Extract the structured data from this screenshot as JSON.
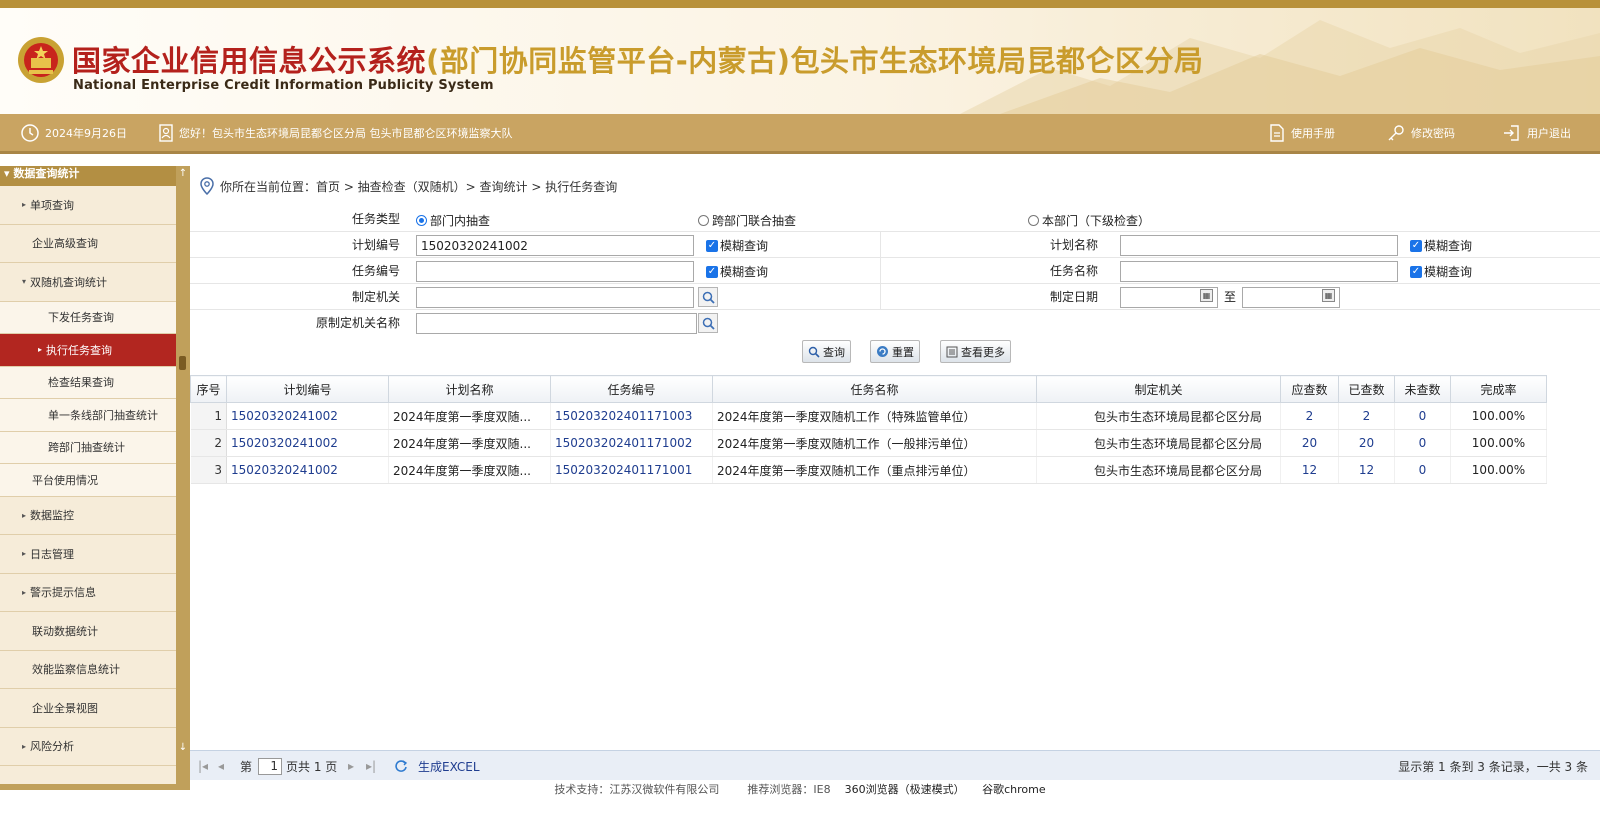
{
  "header": {
    "title_main": "国家企业信用信息公示系统",
    "title_sub": "(部门协同监管平台-内蒙古)包头市生态环境局昆都仑区分局",
    "title_en": "National Enterprise Credit Information Publicity System"
  },
  "toolbar": {
    "date": "2024年9月26日",
    "greeting": "您好！包头市生态环境局昆都仑区分局 包头市昆都仑区环境监察大队",
    "manual": "使用手册",
    "change_password": "修改密码",
    "logout": "用户退出"
  },
  "sidebar": {
    "section_title": "数据查询统计",
    "items": [
      {
        "label": "单项查询",
        "arrow": "▸"
      },
      {
        "label": "企业高级查询",
        "arrow": ""
      },
      {
        "label": "双随机查询统计",
        "arrow": "▾"
      },
      {
        "label": "下发任务查询",
        "arrow": ""
      },
      {
        "label": "执行任务查询",
        "arrow": "▸"
      },
      {
        "label": "检查结果查询",
        "arrow": ""
      },
      {
        "label": "单一条线部门抽查统计",
        "arrow": ""
      },
      {
        "label": "跨部门抽查统计",
        "arrow": ""
      },
      {
        "label": "平台使用情况",
        "arrow": ""
      },
      {
        "label": "数据监控",
        "arrow": "▸"
      },
      {
        "label": "日志管理",
        "arrow": "▸"
      },
      {
        "label": "警示提示信息",
        "arrow": "▸"
      },
      {
        "label": "联动数据统计",
        "arrow": ""
      },
      {
        "label": "效能监察信息统计",
        "arrow": ""
      },
      {
        "label": "企业全景视图",
        "arrow": ""
      },
      {
        "label": "风险分析",
        "arrow": "▸"
      }
    ]
  },
  "breadcrumb": "你所在当前位置：首页 > 抽查检查（双随机）> 查询统计 > 执行任务查询",
  "form": {
    "task_type_label": "任务类型",
    "task_type_options": [
      "部门内抽查",
      "跨部门联合抽查",
      "本部门（下级检查）"
    ],
    "plan_no_label": "计划编号",
    "plan_no_value": "15020320241002",
    "fuzzy_label": "模糊查询",
    "plan_name_label": "计划名称",
    "plan_name_value": "",
    "task_no_label": "任务编号",
    "task_no_value": "",
    "task_name_label": "任务名称",
    "task_name_value": "",
    "org_label": "制定机关",
    "org_value": "",
    "date_label": "制定日期",
    "date_to": "至",
    "orig_org_label": "原制定机关名称",
    "orig_org_value": ""
  },
  "buttons": {
    "query": "查询",
    "reset": "重置",
    "more": "查看更多"
  },
  "table": {
    "headers": [
      "序号",
      "计划编号",
      "计划名称",
      "任务编号",
      "任务名称",
      "制定机关",
      "应查数",
      "已查数",
      "未查数",
      "完成率"
    ],
    "rows": [
      [
        "1",
        "15020320241002",
        "2024年度第一季度双随...",
        "150203202401171003",
        "2024年度第一季度双随机工作（特殊监管单位）",
        "包头市生态环境局昆都仑区分局",
        "2",
        "2",
        "0",
        "100.00%"
      ],
      [
        "2",
        "15020320241002",
        "2024年度第一季度双随...",
        "150203202401171002",
        "2024年度第一季度双随机工作（一般排污单位）",
        "包头市生态环境局昆都仑区分局",
        "20",
        "20",
        "0",
        "100.00%"
      ],
      [
        "3",
        "15020320241002",
        "2024年度第一季度双随...",
        "150203202401171001",
        "2024年度第一季度双随机工作（重点排污单位）",
        "包头市生态环境局昆都仑区分局",
        "12",
        "12",
        "0",
        "100.00%"
      ]
    ]
  },
  "pager": {
    "page_prefix": "第",
    "page_value": "1",
    "page_suffix": "页共 1 页",
    "export": "生成EXCEL",
    "summary": "显示第 1 条到 3 条记录，一共 3 条"
  },
  "footer": {
    "support": "技术支持：江苏汉微软件有限公司",
    "browser_label": "推荐浏览器：IE8",
    "browser_360": "360浏览器（极速模式）",
    "browser_chrome": "谷歌chrome"
  },
  "colors": {
    "brand_red": "#b4211c",
    "brand_gold": "#c99c2c",
    "toolbar": "#c9a462",
    "link_blue": "#1f3d8f"
  }
}
